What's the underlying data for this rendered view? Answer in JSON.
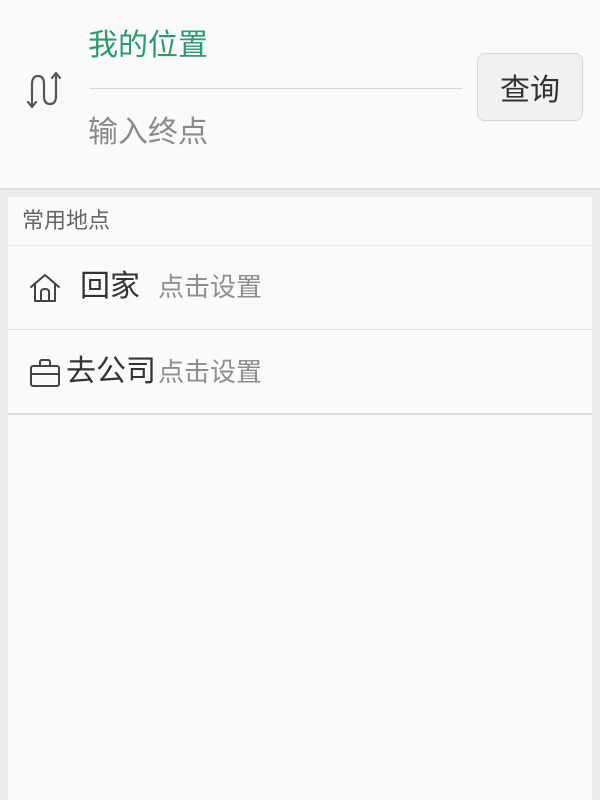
{
  "route": {
    "origin": "我的位置",
    "destination_placeholder": "输入终点",
    "query_label": "查询",
    "swap_icon": "swap-route-icon",
    "origin_color": "#2a9b6f"
  },
  "places": {
    "title": "常用地点",
    "items": [
      {
        "label": "回家",
        "hint": "点击设置",
        "icon": "home-icon"
      },
      {
        "label": "去公司",
        "hint": "点击设置",
        "icon": "briefcase-icon"
      }
    ]
  }
}
